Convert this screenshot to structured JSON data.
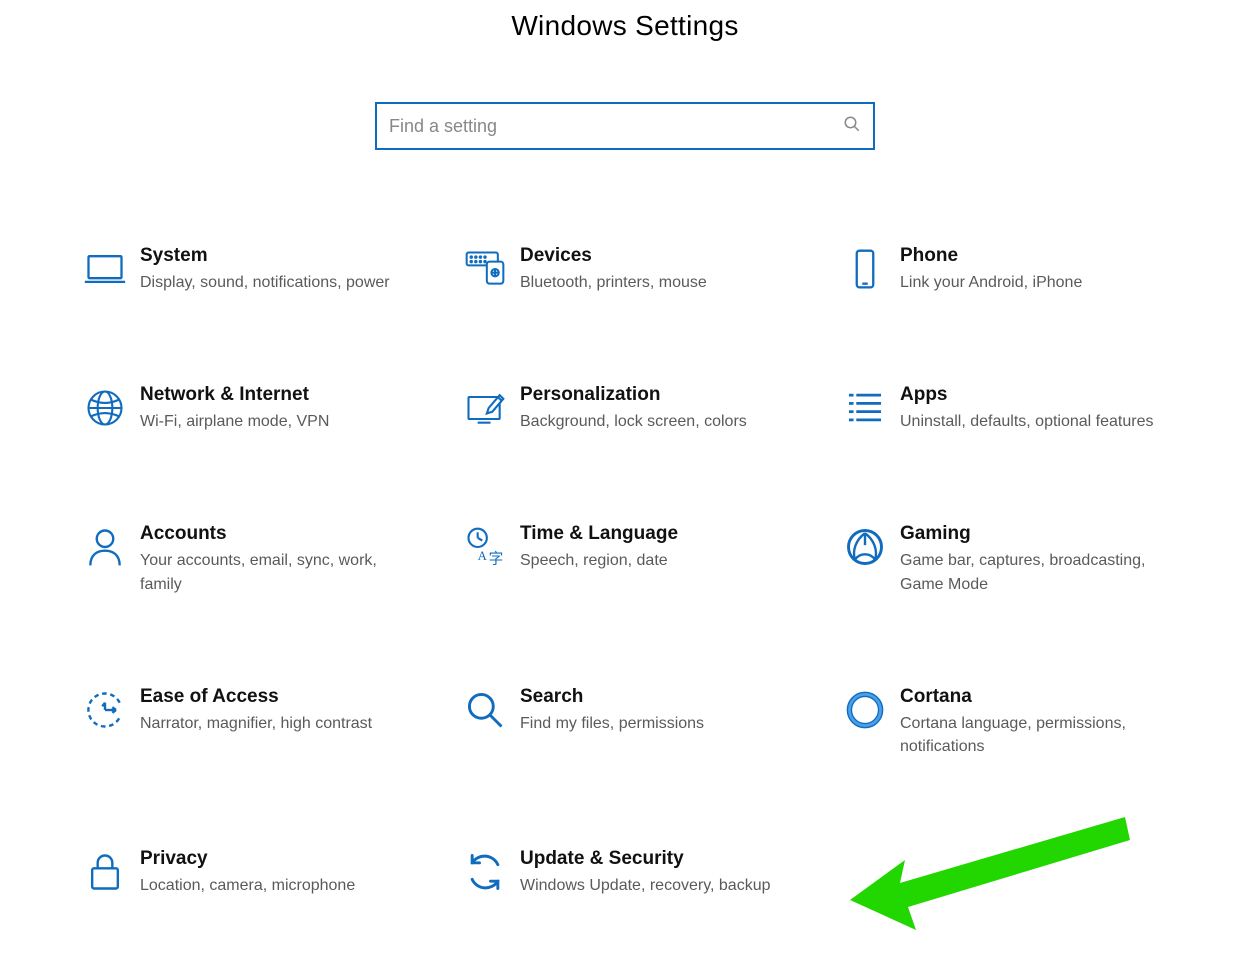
{
  "title": "Windows Settings",
  "search": {
    "placeholder": "Find a setting"
  },
  "tiles": [
    {
      "title": "System",
      "desc": "Display, sound, notifications, power"
    },
    {
      "title": "Devices",
      "desc": "Bluetooth, printers, mouse"
    },
    {
      "title": "Phone",
      "desc": "Link your Android, iPhone"
    },
    {
      "title": "Network & Internet",
      "desc": "Wi-Fi, airplane mode, VPN"
    },
    {
      "title": "Personalization",
      "desc": "Background, lock screen, colors"
    },
    {
      "title": "Apps",
      "desc": "Uninstall, defaults, optional features"
    },
    {
      "title": "Accounts",
      "desc": "Your accounts, email, sync, work, family"
    },
    {
      "title": "Time & Language",
      "desc": "Speech, region, date"
    },
    {
      "title": "Gaming",
      "desc": "Game bar, captures, broadcasting, Game Mode"
    },
    {
      "title": "Ease of Access",
      "desc": "Narrator, magnifier, high contrast"
    },
    {
      "title": "Search",
      "desc": "Find my files, permissions"
    },
    {
      "title": "Cortana",
      "desc": "Cortana language, permissions, notifications"
    },
    {
      "title": "Privacy",
      "desc": "Location, camera, microphone"
    },
    {
      "title": "Update & Security",
      "desc": "Windows Update, recovery, backup"
    }
  ],
  "colors": {
    "accent": "#0f6cbf",
    "arrow": "#22d600"
  }
}
